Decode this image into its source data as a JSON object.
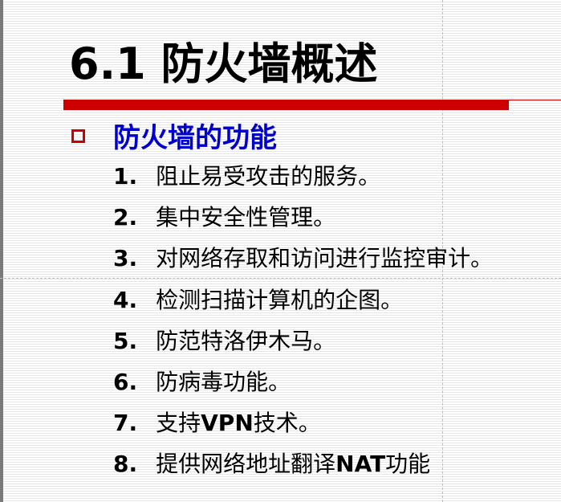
{
  "slide": {
    "title": "6.1 防火墙概述",
    "subtitle": "防火墙的功能",
    "items": [
      {
        "num": "1.",
        "text": "阻止易受攻击的服务。"
      },
      {
        "num": "2.",
        "text": "集中安全性管理。"
      },
      {
        "num": "3.",
        "text": "对网络存取和访问进行监控审计。"
      },
      {
        "num": "4.",
        "text": "检测扫描计算机的企图。"
      },
      {
        "num": "5.",
        "text": "防范特洛伊木马。"
      },
      {
        "num": "6.",
        "text": "防病毒功能。"
      },
      {
        "num": "7.",
        "pre": "支持",
        "bold": "VPN",
        "post": "技术。"
      },
      {
        "num": "8.",
        "pre": "提供网络地址翻译",
        "bold": "NAT",
        "post": "功能"
      }
    ]
  },
  "colors": {
    "accent_red": "#cc0000",
    "subtitle_blue": "#0000cc",
    "text": "#000000"
  }
}
